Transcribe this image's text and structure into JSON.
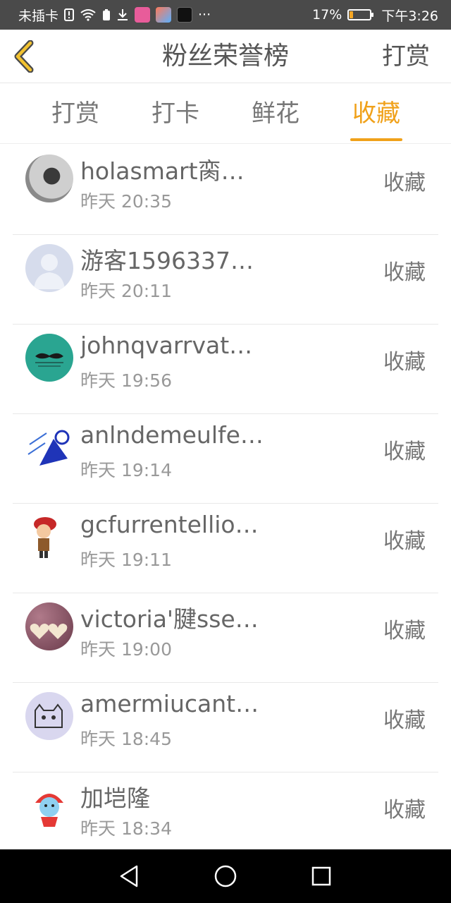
{
  "status_bar": {
    "carrier": "未插卡",
    "battery_percent_text": "17%",
    "battery_level": 0.17,
    "time": "下午3:26",
    "more": "···"
  },
  "header": {
    "title": "粉丝荣誉榜",
    "action_label": "打赏",
    "back_icon": "chevron-left-icon"
  },
  "tabs": [
    {
      "label": "打赏",
      "active": false
    },
    {
      "label": "打卡",
      "active": false
    },
    {
      "label": "鲜花",
      "active": false
    },
    {
      "label": "收藏",
      "active": true
    }
  ],
  "list": [
    {
      "name": "holasmart脔…",
      "time": "昨天 20:35",
      "action": "收藏"
    },
    {
      "name": "游客1596337…",
      "time": "昨天 20:11",
      "action": "收藏"
    },
    {
      "name": "johnqvarrvat…",
      "time": "昨天 19:56",
      "action": "收藏"
    },
    {
      "name": "anlndemeulfe…",
      "time": "昨天 19:14",
      "action": "收藏"
    },
    {
      "name": "gcfurrentellio…",
      "time": "昨天 19:11",
      "action": "收藏"
    },
    {
      "name": "victoria'腱sse…",
      "time": "昨天 19:00",
      "action": "收藏"
    },
    {
      "name": "amermiucant…",
      "time": "昨天 18:45",
      "action": "收藏"
    },
    {
      "name": "加垲隆",
      "time": "昨天 18:34",
      "action": "收藏"
    }
  ],
  "colors": {
    "accent": "#f0a11a",
    "status_bar_bg": "#4a4a4a",
    "nav_bar_bg": "#000000"
  }
}
